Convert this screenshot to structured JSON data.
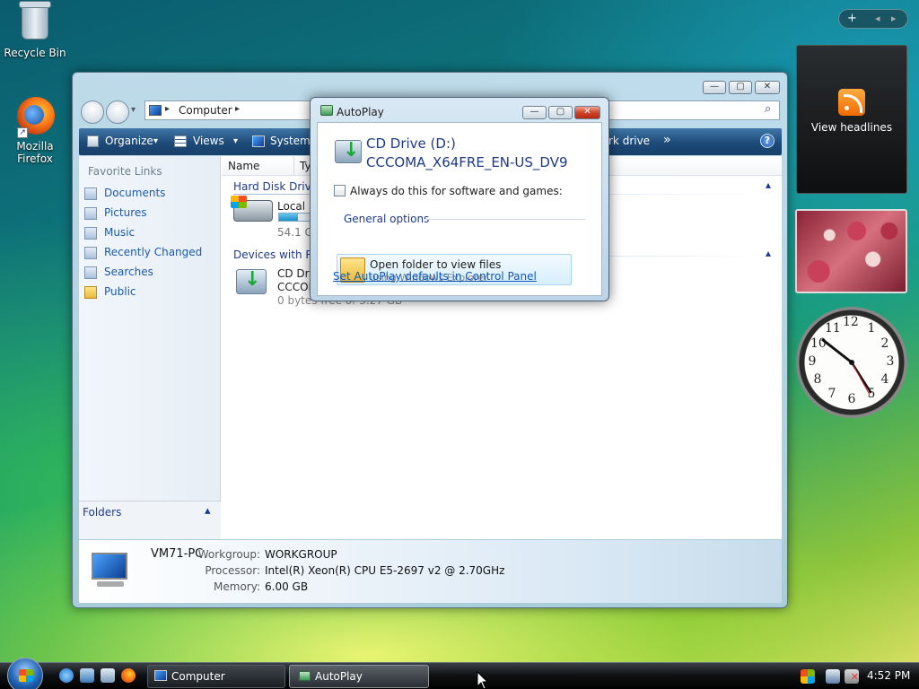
{
  "desktop": {
    "icons": [
      {
        "label": "Recycle Bin"
      },
      {
        "label_line1": "Mozilla",
        "label_line2": "Firefox"
      }
    ]
  },
  "sidebar": {
    "controls": {
      "add": "+",
      "prev": "◂",
      "next": "▸"
    },
    "feed_gadget": {
      "label": "View headlines"
    },
    "clock_numbers": [
      "12",
      "1",
      "2",
      "3",
      "4",
      "5",
      "6",
      "7",
      "8",
      "9",
      "10",
      "11"
    ]
  },
  "explorer": {
    "address": {
      "path": "Computer",
      "sep": "▸"
    },
    "caption_buttons": {
      "minimize": "—",
      "maximize": "▢",
      "close": "✕"
    },
    "toolbar": {
      "organize": "Organize",
      "views": "Views",
      "system_properties": "System p",
      "map_network_drive": "rk drive",
      "more": "»",
      "help": "?",
      "dropdown": "▾"
    },
    "nav": {
      "title": "Favorite Links",
      "items": [
        "Documents",
        "Pictures",
        "Music",
        "Recently Changed",
        "Searches",
        "Public"
      ],
      "folders_label": "Folders",
      "folders_chevron": "▴"
    },
    "columns": {
      "name": "Name",
      "type": "Ty"
    },
    "groups": {
      "hard_disk": {
        "label": "Hard Disk Drives",
        "chevron": "▴"
      },
      "removable": {
        "label": "Devices with Rer",
        "chevron": "▴"
      }
    },
    "drives": {
      "local": {
        "name": "Local D",
        "size": "54.1 GB",
        "fill_fraction": 0.55
      },
      "cd": {
        "name": "CD Driv",
        "label": "CCCON",
        "free": "0 bytes free of 3.27 GB"
      }
    },
    "details": {
      "computer_name": "VM71-PC",
      "workgroup_label": "Workgroup:",
      "workgroup": "WORKGROUP",
      "processor_label": "Processor:",
      "processor": "Intel(R) Xeon(R) CPU E5-2697 v2 @ 2.70GHz",
      "memory_label": "Memory:",
      "memory": "6.00 GB"
    }
  },
  "autoplay": {
    "title": "AutoPlay",
    "drive_line1": "CD Drive (D:)",
    "drive_line2": "CCCOMA_X64FRE_EN-US_DV9",
    "checkbox_label": "Always do this for software and games:",
    "section": "General options",
    "option_title": "Open folder to view files",
    "option_subtitle": "using Windows Explorer",
    "link": "Set AutoPlay defaults in Control Panel",
    "buttons": {
      "minimize": "—",
      "maximize": "▢",
      "close": "✕"
    }
  },
  "taskbar": {
    "tasks": [
      {
        "label": "Computer"
      },
      {
        "label": "AutoPlay"
      }
    ],
    "clock": "4:52 PM"
  },
  "colors": {
    "toolbar": "#1d4a78",
    "link": "#0f57b8",
    "group_header": "#1e3a8a",
    "close_red": "#d0462a"
  }
}
